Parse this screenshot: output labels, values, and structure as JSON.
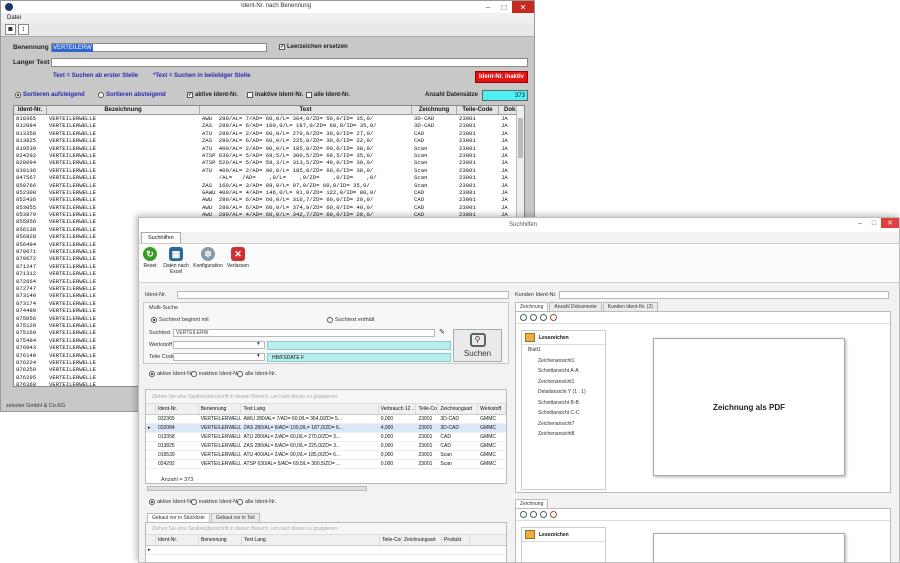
{
  "win1": {
    "title": "Ident-Nr. nach Benennung",
    "menu": "Datei",
    "benennung_label": "Benennung",
    "benennung_value": "VERTEILERW",
    "leerzeichen_label": "Leerzeichen ersetzen",
    "langer_text_label": "Langer Text",
    "hint1": "Text = Suchen ab erster Stelle",
    "hint2": "*Text = Suchen in beliebiger Stelle",
    "inaktiv_button": "Ident-Nr. inaktiv",
    "sort_asc": "Sortieren aufsteigend",
    "sort_desc": "Sortieren absteigend",
    "aktive": "aktive Ident-Nr.",
    "inaktive": "inaktive Ident-Nr.",
    "alle": "alle Ident-Nr.",
    "anzahl_label": "Anzahl Datensätze",
    "anzahl_value": "373",
    "columns": [
      "Ident-Nr.",
      "Bezeichnung",
      "Text",
      "Zeichnung",
      "Teile-Code",
      "Dok."
    ],
    "rows": [
      [
        "810365",
        "VERTEILERWELLE",
        "AWU  280/AL= 7/AD= 60,0/L= 364,0/ZD= 50,0/ID= 35,0/",
        "3D-CAD",
        "23001",
        "JA"
      ],
      [
        "812084",
        "VERTEILERWELLE",
        "ZAS  280/AL= 6/AD= 100,0/L= 187,0/ZD= 60,0/ID= 35,0/",
        "3D-CAD",
        "23001",
        "JA"
      ],
      [
        "813358",
        "VERTEILERWELLE",
        "ATU  280/AL= 2/AD= 60,0/L= 270,0/ZD= 30,0/ID= 27,0/",
        "CAD",
        "23001",
        "JA"
      ],
      [
        "813825",
        "VERTEILERWELLE",
        "ZAS  280/AL= 6/AD= 60,0/L= 225,0/ZD= 30,0/ID= 22,0/",
        "CAD",
        "23001",
        "JA"
      ],
      [
        "819539",
        "VERTEILERWELLE",
        "ATU  400/AL= 2/AD= 90,0/L= 185,0/ZD= 60,0/ID= 38,0/",
        "Scan",
        "23001",
        "JA"
      ],
      [
        "824292",
        "VERTEILERWELLE",
        "ATSP 630/AL= 5/AD= 69,5/L= 300,5/ZD= 69,5/ID= 35,0/",
        "Scan",
        "23001",
        "JA"
      ],
      [
        "828094",
        "VERTEILERWELLE",
        "ATSP 520/AL= 5/AD= 59,3/L= 313,5/ZD= 49,0/ID= 30,0/",
        "Scan",
        "23001",
        "JA"
      ],
      [
        "839136",
        "VERTEILERWELLE",
        "ATU  400/AL= 2/AD= 90,0/L= 185,0/ZD= 60,0/ID= 38,0/",
        "Scan",
        "23001",
        "JA"
      ],
      [
        "847567",
        "VERTEILERWELLE",
        "     /AL=   /AD=    ,0/L=    ,0/ZD=    ,0/ID=    ,0/",
        "Scan",
        "23001",
        "JA"
      ],
      [
        "850766",
        "VERTEILERWELLE",
        "ZAS  160/AL= 3/AD= 89,0/L= 97,0/ZD= 60,0/ID= 35,0/",
        "Scan",
        "23001",
        "JA"
      ],
      [
        "852308",
        "VERTEILERWELLE",
        "GAWU 400/AL= 4/AD= 146,0/L= 91,0/ZD= 122,0/ID= 80,0/",
        "CAD",
        "23001",
        "JA"
      ],
      [
        "852436",
        "VERTEILERWELLE",
        "AWU  280/AL= 6/AD= 60,0/L= 316,7/ZD= 60,0/ID= 20,0/",
        "CAD",
        "23001",
        "JA"
      ],
      [
        "853055",
        "VERTEILERWELLE",
        "AWU  280/AL= 6/AD= 60,0/L= 374,9/ZD= 60,0/ID= 40,0/",
        "CAD",
        "23001",
        "JA"
      ],
      [
        "853879",
        "VERTEILERWELLE",
        "AWU  280/AL= 4/AD= 60,0/L= 342,7/ZD= 60,0/ID= 20,0/",
        "CAD",
        "23001",
        "JA"
      ],
      [
        "855956",
        "VERTEILERWELLE",
        "",
        "",
        "",
        ""
      ],
      [
        "856138",
        "VERTEILERWELLE",
        "",
        "",
        "",
        ""
      ],
      [
        "856828",
        "VERTEILERWELLE",
        "",
        "",
        "",
        ""
      ],
      [
        "856494",
        "VERTEILERWELLE",
        "",
        "",
        "",
        ""
      ],
      [
        "870671",
        "VERTEILERWELLE",
        "",
        "",
        "",
        ""
      ],
      [
        "870672",
        "VERTEILERWELLE",
        "",
        "",
        "",
        ""
      ],
      [
        "871247",
        "VERTEILERWELLE",
        "",
        "",
        "",
        ""
      ],
      [
        "871312",
        "VERTEILERWELLE",
        "",
        "",
        "",
        ""
      ],
      [
        "872664",
        "VERTEILERWELLE",
        "",
        "",
        "",
        ""
      ],
      [
        "872747",
        "VERTEILERWELLE",
        "",
        "",
        "",
        ""
      ],
      [
        "873140",
        "VERTEILERWELLE",
        "",
        "",
        "",
        ""
      ],
      [
        "873174",
        "VERTEILERWELLE",
        "",
        "",
        "",
        ""
      ],
      [
        "874480",
        "VERTEILERWELLE",
        "",
        "",
        "",
        ""
      ],
      [
        "875056",
        "VERTEILERWELLE",
        "",
        "",
        "",
        ""
      ],
      [
        "875120",
        "VERTEILERWELLE",
        "",
        "",
        "",
        ""
      ],
      [
        "875169",
        "VERTEILERWELLE",
        "",
        "",
        "",
        ""
      ],
      [
        "875484",
        "VERTEILERWELLE",
        "",
        "",
        "",
        ""
      ],
      [
        "876043",
        "VERTEILERWELLE",
        "",
        "",
        "",
        ""
      ],
      [
        "876140",
        "VERTEILERWELLE",
        "",
        "",
        "",
        ""
      ],
      [
        "876224",
        "VERTEILERWELLE",
        "",
        "",
        "",
        ""
      ],
      [
        "876259",
        "VERTEILERWELLE",
        "",
        "",
        "",
        ""
      ],
      [
        "876295",
        "VERTEILERWELLE",
        "",
        "",
        "",
        ""
      ],
      [
        "876360",
        "VERTEILERWELLE",
        "",
        "",
        "",
        ""
      ],
      [
        "876372",
        "VERTEILERWELLE",
        "",
        "",
        "",
        ""
      ]
    ],
    "footer": "zeissler GmbH & Co.KG"
  },
  "win2": {
    "title": "Suchhilfen",
    "tab": "Suchhilfen",
    "ribbon": {
      "reset": "Reset",
      "excel": "Daten nach Excel",
      "konfig": "Konfiguration",
      "verlassen": "Verlassen"
    },
    "ident_label": "Ident-Nr.",
    "kunden_label": "Kunden Ident-Nr.",
    "multisuche": "Multi-Suche",
    "begins": "Suchtext beginnt mit",
    "contains": "Suchtext enthält",
    "suchtext_label": "Suchtext",
    "suchtext_value": "VERTEILERW",
    "werkstoff_label": "Werkstoff",
    "teilecode_label": "Teile Code",
    "teilecode_value": "HB/FSDATE F",
    "suchen": "Suchen",
    "aktive": "aktive Ident-Nr.",
    "inaktive": "inaktive Ident-Nr.",
    "alle": "alle Ident-Nr.",
    "group_hint": "Ziehen Sie eine Spaltenüberschrift in diesen Bereich, um nach dieser zu gruppieren",
    "columns": [
      "",
      "Ident-Nr.",
      "Benennung",
      "Text Lang",
      "Verbrauch 12 ...",
      "Teile-Code",
      "Zeichnungsart",
      "Werkstoff"
    ],
    "rows": [
      [
        "",
        "032365",
        "VERTEILERWELLE",
        "AWU  280/AL= 7/AD= 60,0/L= 364,0/ZD= 5...",
        "0,000",
        "23001",
        "3D-CAD",
        "GMMC"
      ],
      [
        "▸",
        "032084",
        "VERTEILERWELLE",
        "ZAS  280/AL= 6/AD= 100,0/L= 187,0/ZD= 6...",
        "4,000",
        "23001",
        "3D-CAD",
        "GMMC"
      ],
      [
        "",
        "013358",
        "VERTEILERWELLE",
        "ATU  280/AL= 2/AD= 60,0/L= 270,0/ZD= 3...",
        "0,000",
        "23001",
        "CAD",
        "GMMC"
      ],
      [
        "",
        "013825",
        "VERTEILERWELLE",
        "ZAS  280/AL= 6/AD= 60,0/L= 225,0/ZD= 3...",
        "0,000",
        "23001",
        "CAD",
        "GMMC"
      ],
      [
        "",
        "019539",
        "VERTEILERWELLE",
        "ATU  400/AL= 2/AD= 90,0/L= 185,0/ZD= 6...",
        "0,000",
        "23001",
        "Scan",
        "GMMC"
      ],
      [
        "",
        "024292",
        "VERTEILERWELLE",
        "ATSP  630/AL= 5/AD= 69,5/L= 300,5/ZD= ...",
        "0,000",
        "23001",
        "Scan",
        "GMMC"
      ]
    ],
    "anzahl": "Anzahl = 373",
    "lower_tabs": [
      "Gebaut vor  in Stückliste",
      "Gebaut vor in Teil"
    ],
    "lower_group_hint": "Ziehen Sie eine Spaltenüberschrift in diesen Bereich, um nach dieser zu gruppieren",
    "lower_columns": [
      "",
      "Ident-Nr.",
      "Benennung",
      "Text Lang",
      "Teile-Code",
      "Zeichnungsart",
      "Produkt"
    ],
    "right_tabs": [
      "Zeichnung",
      "Anzahl Dokumente",
      "Kunden Ident-Nr. (2)"
    ],
    "lesezeichen": "Lesezeichen",
    "tree": [
      "Blatt1",
      "Zeichenansicht1",
      "Schnittansicht A-A",
      "Zeichenansicht1",
      "Detailansicht Y (1 : 1)",
      "Schnittansicht B-B",
      "Schnittansicht C-C",
      "Zeichenansicht7",
      "Zeichenansicht8"
    ],
    "page_text": "Zeichnung als PDF",
    "lower_right_tab": "Zeichnung"
  }
}
